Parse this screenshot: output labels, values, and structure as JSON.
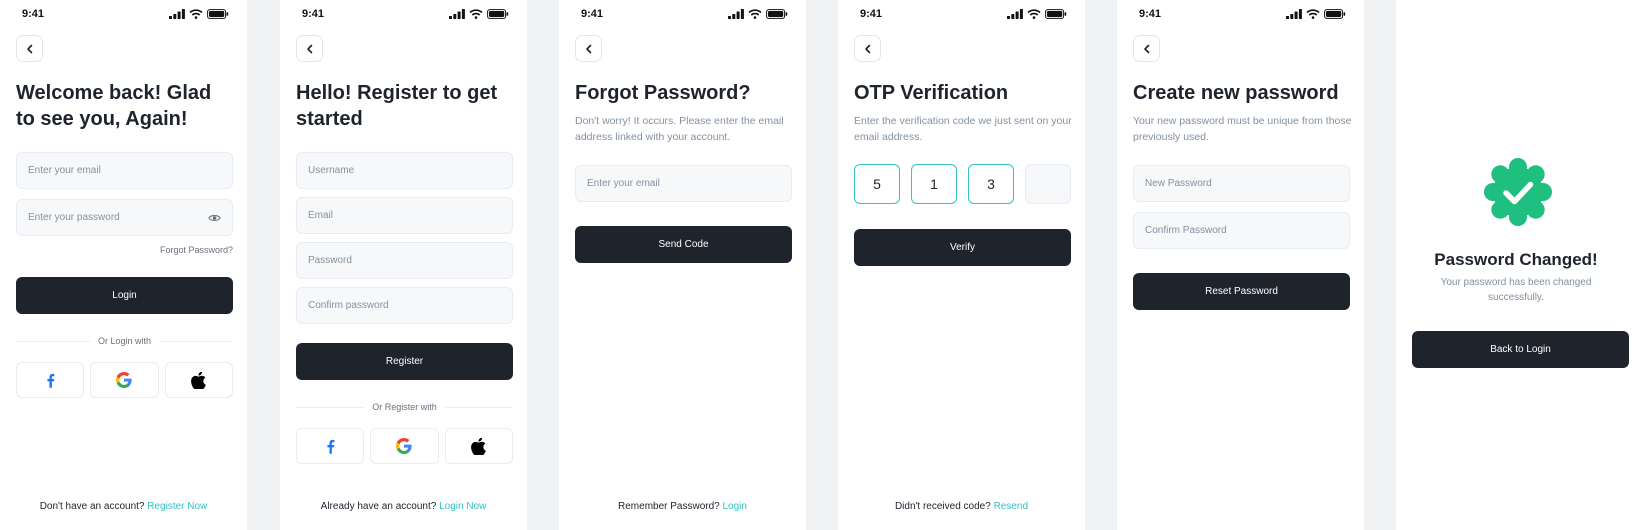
{
  "status_time": "9:41",
  "colors": {
    "primary": "#1e232c",
    "accent": "#35c2c1",
    "success": "#1ebf7f",
    "field_bg": "#f7f8f9"
  },
  "login": {
    "title_line1": "Welcome back! Glad",
    "title_line2": "to see you, Again!",
    "email_placeholder": "Enter your email",
    "password_placeholder": "Enter your password",
    "forgot": "Forgot Password?",
    "button": "Login",
    "divider": "Or Login with",
    "footer_text": "Don't have an account? ",
    "footer_link": "Register Now"
  },
  "register": {
    "title_line1": "Hello! Register to get",
    "title_line2": "started",
    "fields": [
      "Username",
      "Email",
      "Password",
      "Confirm password"
    ],
    "button": "Register",
    "divider": "Or Register with",
    "footer_text": "Already have an account? ",
    "footer_link": "Login Now"
  },
  "forgot": {
    "title": "Forgot Password?",
    "subtitle": "Don't worry! It occurs. Please enter the email address linked with your account.",
    "email_placeholder": "Enter your email",
    "button": "Send Code",
    "footer_text": "Remember Password? ",
    "footer_link": "Login"
  },
  "otp": {
    "title": "OTP Verification",
    "subtitle": "Enter the verification code we just sent on your email address.",
    "digits": [
      "5",
      "1",
      "3",
      ""
    ],
    "button": "Verify",
    "footer_text": "Didn't received code? ",
    "footer_link": "Resend"
  },
  "newpass": {
    "title": "Create new password",
    "subtitle": "Your new password must be unique from those previously used.",
    "new_placeholder": "New Password",
    "confirm_placeholder": "Confirm Password",
    "button": "Reset Password"
  },
  "changed": {
    "title": "Password Changed!",
    "subtitle": "Your password has been changed successfully.",
    "button": "Back to Login"
  },
  "icons": [
    "back-icon",
    "eye-icon",
    "facebook-icon",
    "google-icon",
    "apple-icon",
    "check-badge-icon",
    "signal-icon",
    "wifi-icon",
    "battery-icon"
  ]
}
